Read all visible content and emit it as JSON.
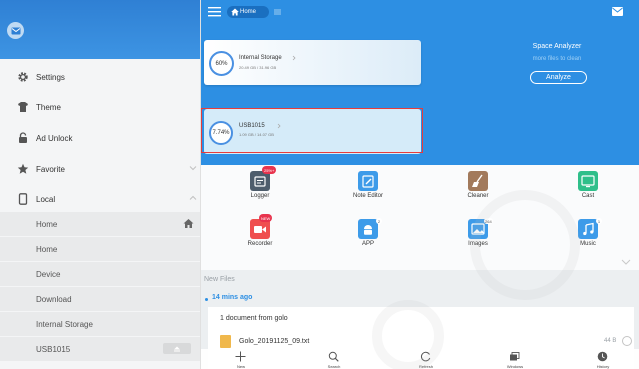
{
  "colors": {
    "brand_blue": "#2d8fe3",
    "sidebar_bg": "#f4f5f6",
    "highlight_red": "#e63c3c",
    "badge_red": "#e8344e"
  },
  "sidebar": {
    "avatar_icon": "mail-icon",
    "items": [
      {
        "label": "Settings",
        "icon": "gear-icon"
      },
      {
        "label": "Theme",
        "icon": "shirt-icon"
      },
      {
        "label": "Ad Unlock",
        "icon": "lock-icon"
      },
      {
        "label": "Favorite",
        "icon": "star-icon"
      },
      {
        "label": "Local",
        "icon": "phone-icon"
      }
    ],
    "local_items": [
      "Home",
      "Home",
      "Device",
      "Download",
      "Internal Storage",
      "USB1015"
    ]
  },
  "header": {
    "breadcrumb": "Home",
    "storage": [
      {
        "name": "Internal Storage",
        "percent": "60%",
        "size": "20.49 GB / 31.96 GB"
      },
      {
        "name": "USB1015",
        "percent": "7.74%",
        "size": "1.09 GB / 14.07 GB"
      }
    ],
    "analyzer": {
      "title": "Space Analyzer",
      "subtitle": "more files to clean",
      "button": "Analyze"
    }
  },
  "tools": [
    {
      "label": "Logger",
      "icon": "logger-icon",
      "color": "#4e5d6c",
      "badge": "25%+"
    },
    {
      "label": "Note Editor",
      "icon": "note-editor-icon",
      "color": "#3d9be9"
    },
    {
      "label": "Cleaner",
      "icon": "broom-icon",
      "color": "#a27a5c"
    },
    {
      "label": "Cast",
      "icon": "cast-icon",
      "color": "#2fbf8a"
    },
    {
      "label": "Recorder",
      "icon": "video-recorder-icon",
      "color": "#ef4f4f",
      "badge": "NEW"
    },
    {
      "label": "APP",
      "icon": "android-icon",
      "color": "#3d9be9",
      "count": "2"
    },
    {
      "label": "Images",
      "icon": "image-icon",
      "color": "#3d9be9",
      "count": "264"
    },
    {
      "label": "Music",
      "icon": "music-icon",
      "color": "#3d9be9",
      "count": "1"
    }
  ],
  "new_files": {
    "label": "New Files",
    "time": "14 mins ago",
    "group_title": "1 document from golo",
    "file_name": "Golo_20191125_09.txt",
    "file_size": "44 B"
  },
  "toolbar": [
    {
      "label": "New",
      "icon": "plus-icon"
    },
    {
      "label": "Search",
      "icon": "search-icon"
    },
    {
      "label": "Refresh",
      "icon": "refresh-icon"
    },
    {
      "label": "Windows",
      "icon": "windows-icon"
    },
    {
      "label": "History",
      "icon": "history-icon"
    }
  ]
}
